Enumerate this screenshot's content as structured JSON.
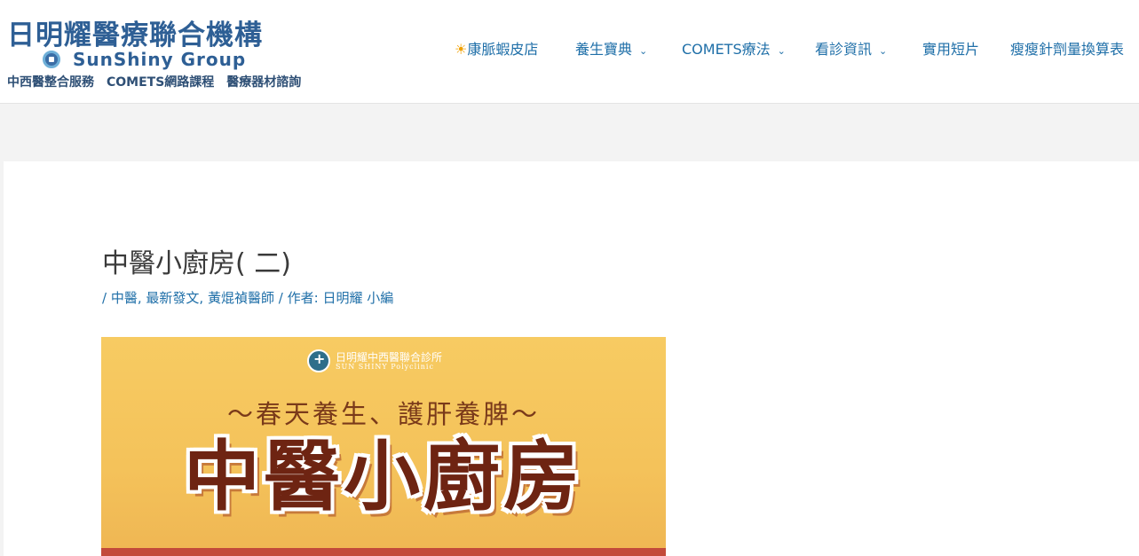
{
  "logo": {
    "title": "日明耀醫療聯合機構",
    "english": "SunShiny Group",
    "subtitle": "中西醫整合服務　COMETS網路課程　醫療器材諮詢"
  },
  "nav": {
    "items": [
      {
        "label": "康脈蝦皮店",
        "icon": "sun-icon",
        "has_dropdown": false
      },
      {
        "label": "養生寶典",
        "has_dropdown": true
      },
      {
        "label": "COMETS療法",
        "has_dropdown": true
      },
      {
        "label": "看診資訊",
        "has_dropdown": true
      },
      {
        "label": "實用短片",
        "has_dropdown": false
      },
      {
        "label": "瘦瘦針劑量換算表",
        "has_dropdown": false
      }
    ]
  },
  "post": {
    "title": "中醫小廚房( 二)",
    "meta": {
      "prefix": "/",
      "categories": [
        "中醫",
        "最新發文",
        "黃焜禎醫師"
      ],
      "author_label": "/ 作者:",
      "author": "日明耀 小編"
    }
  },
  "poster": {
    "clinic_name": "日明耀中西醫聯合診所",
    "clinic_english": "SUN SHINY Polyclinic",
    "subtitle": "～春天養生、護肝養脾～",
    "main_text": "中醫小廚房"
  },
  "colors": {
    "link": "#1f6fa8",
    "logo_blue": "#2e5f95",
    "poster_bg": "#f4c25a",
    "poster_text": "#6e2412"
  }
}
